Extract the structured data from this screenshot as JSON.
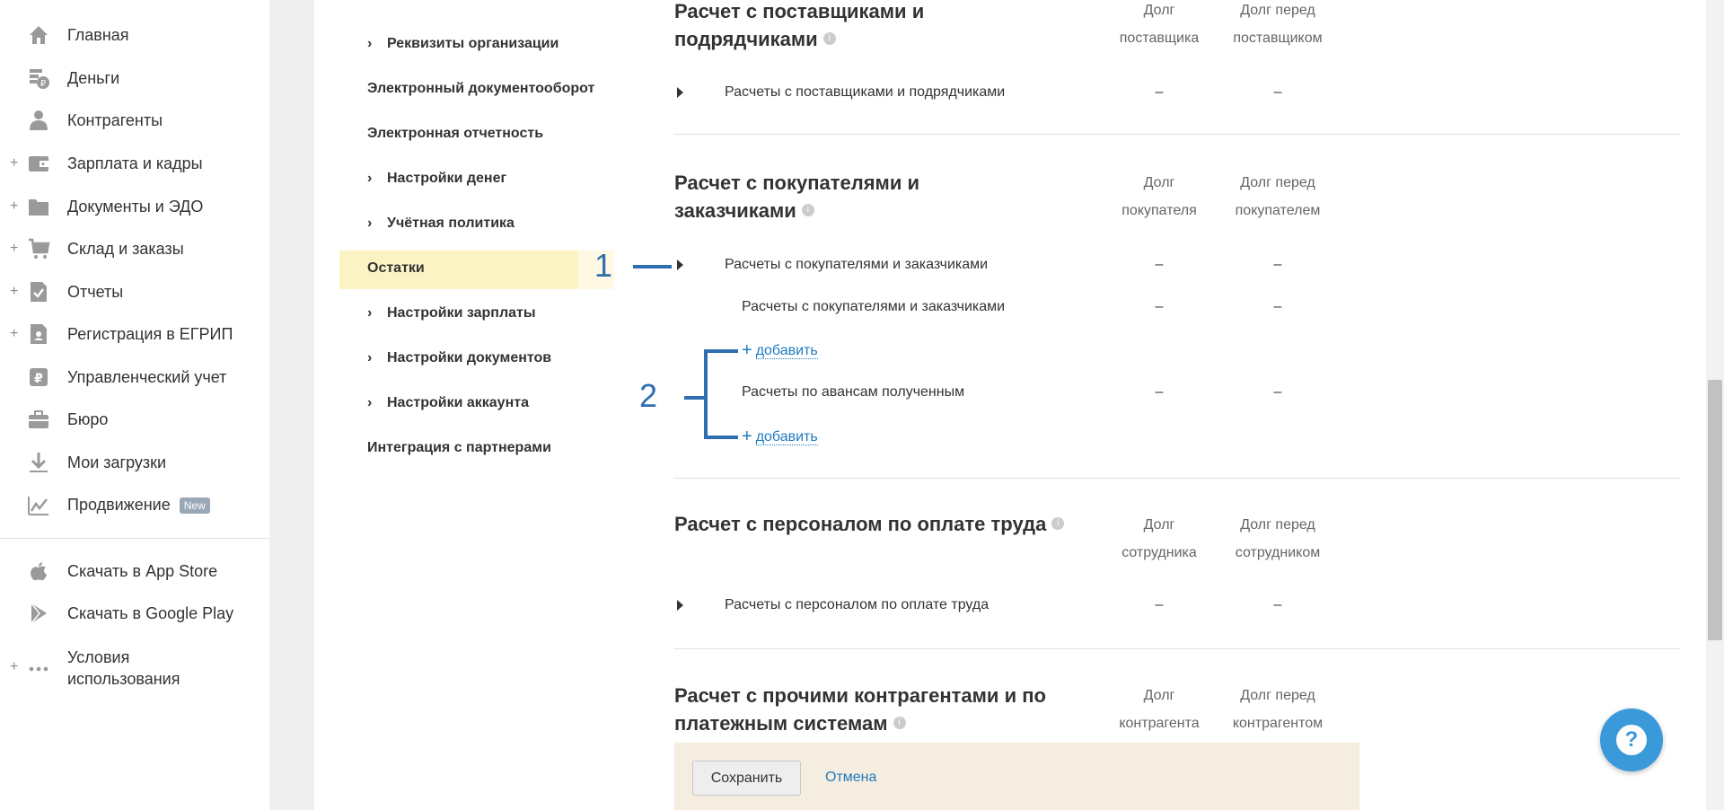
{
  "sidebar": {
    "items": [
      {
        "label": "Главная",
        "icon": "home-icon",
        "plus": false
      },
      {
        "label": "Деньги",
        "icon": "money-icon",
        "plus": false
      },
      {
        "label": "Контрагенты",
        "icon": "contractors-icon",
        "plus": false
      },
      {
        "label": "Зарплата и кадры",
        "icon": "wallet-icon",
        "plus": true
      },
      {
        "label": "Документы и ЭДО",
        "icon": "folder-icon",
        "plus": true
      },
      {
        "label": "Склад и заказы",
        "icon": "cart-icon",
        "plus": true
      },
      {
        "label": "Отчеты",
        "icon": "report-icon",
        "plus": true
      },
      {
        "label": "Регистрация в ЕГРИП",
        "icon": "registration-icon",
        "plus": true
      },
      {
        "label": "Управленческий учет",
        "icon": "management-icon",
        "plus": false
      },
      {
        "label": "Бюро",
        "icon": "briefcase-icon",
        "plus": false
      },
      {
        "label": "Мои загрузки",
        "icon": "download-icon",
        "plus": false
      },
      {
        "label": "Продвижение",
        "icon": "growth-chart-icon",
        "plus": false,
        "badge": "New"
      }
    ],
    "bottom_items": [
      {
        "label": "Скачать в App Store",
        "icon": "apple-icon"
      },
      {
        "label": "Скачать в Google Play",
        "icon": "google-play-icon"
      },
      {
        "label_line1": "Условия",
        "label_line2": "использования",
        "icon": "more-dots-icon"
      }
    ]
  },
  "settings_menu": [
    {
      "label": "Реквизиты организации",
      "chevron": true
    },
    {
      "label": "Электронный документооборот",
      "chevron": false
    },
    {
      "label": "Электронная отчетность",
      "chevron": false
    },
    {
      "label": "Настройки денег",
      "chevron": true
    },
    {
      "label": "Учётная политика",
      "chevron": true
    },
    {
      "label": "Остатки",
      "chevron": false,
      "active": true
    },
    {
      "label": "Настройки зарплаты",
      "chevron": true
    },
    {
      "label": "Настройки документов",
      "chevron": true
    },
    {
      "label": "Настройки аккаунта",
      "chevron": true
    },
    {
      "label": "Интеграция с партнерами",
      "chevron": false
    }
  ],
  "sections": {
    "suppliers": {
      "title_line1": "Расчет с поставщиками и",
      "title_line2": "подрядчиками",
      "col1_line1": "Долг",
      "col1_line2": "поставщика",
      "col2_line1": "Долг перед",
      "col2_line2": "поставщиком",
      "row": {
        "label": "Расчеты с поставщиками и подрядчиками",
        "v1": "–",
        "v2": "–"
      }
    },
    "buyers": {
      "title_line1": "Расчет с покупателями и",
      "title_line2": "заказчиками",
      "col1_line1": "Долг",
      "col1_line2": "покупателя",
      "col2_line1": "Долг перед",
      "col2_line2": "покупателем",
      "row": {
        "label": "Расчеты с покупателями и заказчиками",
        "v1": "–",
        "v2": "–"
      },
      "sub1": {
        "label": "Расчеты с покупателями и заказчиками",
        "v1": "–",
        "v2": "–"
      },
      "add_label": "добавить",
      "sub2": {
        "label": "Расчеты по авансам полученным",
        "v1": "–",
        "v2": "–"
      }
    },
    "personnel": {
      "title": "Расчет с персоналом по оплате труда",
      "col1_line1": "Долг",
      "col1_line2": "сотрудника",
      "col2_line1": "Долг перед",
      "col2_line2": "сотрудником",
      "row": {
        "label": "Расчеты с персоналом по оплате труда",
        "v1": "–",
        "v2": "–"
      }
    },
    "others": {
      "title_line1": "Расчет с прочими контрагентами и по",
      "title_line2": "платежным системам",
      "col1_line1": "Долг",
      "col1_line2": "контрагента",
      "col2_line1": "Долг перед",
      "col2_line2": "контрагентом"
    }
  },
  "annotations": {
    "one": "1",
    "two": "2"
  },
  "footer": {
    "save_label": "Сохранить",
    "cancel_label": "Отмена"
  },
  "help": {
    "symbol": "?"
  },
  "colors": {
    "accent": "#3a9ad9",
    "link": "#1f7bbf",
    "annotation": "#2f6fb0",
    "active_bg": "#fbf3c4"
  }
}
